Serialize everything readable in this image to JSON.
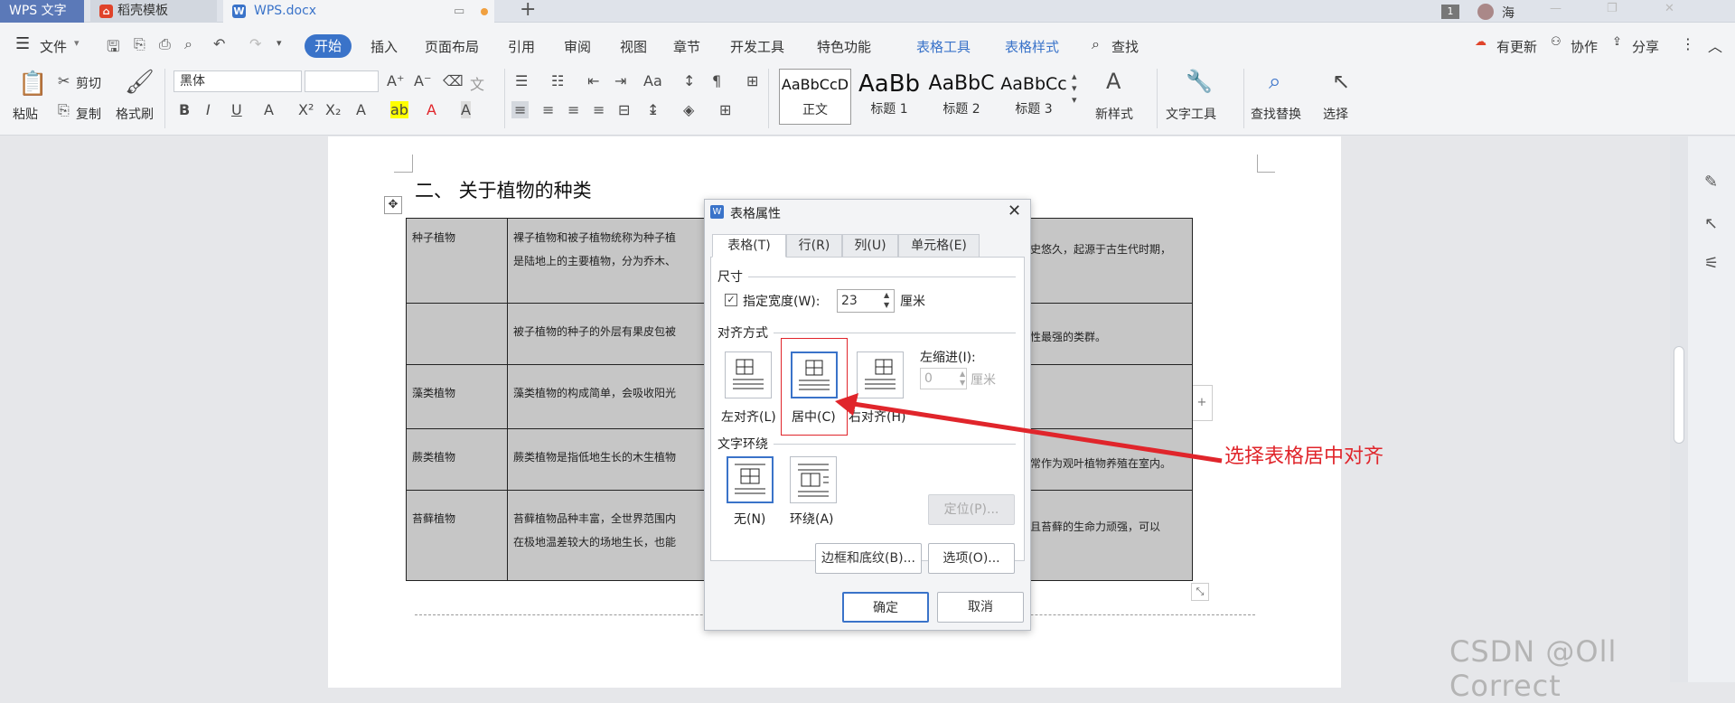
{
  "title_tabs": {
    "app": "WPS 文字",
    "template": "稻壳模板",
    "doc": "WPS.docx",
    "user_count": "1",
    "user_name": "海"
  },
  "menu": {
    "file": "文件",
    "start": "开始",
    "items": [
      "插入",
      "页面布局",
      "引用",
      "审阅",
      "视图",
      "章节",
      "开发工具",
      "特色功能"
    ],
    "table_tools": "表格工具",
    "table_style": "表格样式",
    "search": "查找",
    "update": "有更新",
    "collab": "协作",
    "share": "分享"
  },
  "ribbon": {
    "paste": "粘贴",
    "cut": "剪切",
    "copy": "复制",
    "format_painter": "格式刷",
    "font": "黑体",
    "styles": [
      {
        "sample": "AaBbCcD",
        "name": "正文"
      },
      {
        "sample": "AaBb",
        "name": "标题 1"
      },
      {
        "sample": "AaBbC",
        "name": "标题 2"
      },
      {
        "sample": "AaBbCc",
        "name": "标题 3"
      }
    ],
    "new_style": "新样式",
    "text_tools": "文字工具",
    "find_replace": "查找替换",
    "select": "选择"
  },
  "doc": {
    "heading": "二、 关于植物的种类",
    "rows": [
      {
        "name": "种子植物",
        "desc_left": "裸子植物和被子植物统称为种子植",
        "desc_left2": "是陆地上的主要植物，分为乔木、",
        "desc_right": "史悠久，起源于古生代时期，"
      },
      {
        "name": "",
        "desc_left": "被子植物的种子的外层有果皮包被",
        "desc_left2": "",
        "desc_right": "性最强的类群。"
      },
      {
        "name": "藻类植物",
        "desc_left": "藻类植物的构成简单，会吸收阳光",
        "desc_left2": "",
        "desc_right": ""
      },
      {
        "name": "蕨类植物",
        "desc_left": "蕨类植物是指低地生长的木生植物",
        "desc_left2": "",
        "desc_right": "常作为观叶植物养殖在室内。"
      },
      {
        "name": "苔藓植物",
        "desc_left": "苔藓植物品种丰富，全世界范围内",
        "desc_left2": "在极地温差较大的场地生长，也能",
        "desc_right": "且苔藓的生命力顽强，可以"
      }
    ]
  },
  "dialog": {
    "title": "表格属性",
    "tabs": [
      "表格(T)",
      "行(R)",
      "列(U)",
      "单元格(E)"
    ],
    "size_label": "尺寸",
    "specify_width": "指定宽度(W):",
    "width_value": "23",
    "unit": "厘米",
    "align_label": "对齐方式",
    "align_left": "左对齐(L)",
    "align_center": "居中(C)",
    "align_right": "右对齐(H)",
    "indent_label": "左缩进(I):",
    "indent_value": "0",
    "indent_unit": "厘米",
    "wrap_label": "文字环绕",
    "wrap_none": "无(N)",
    "wrap_around": "环绕(A)",
    "position_btn": "定位(P)...",
    "border_btn": "边框和底纹(B)...",
    "options_btn": "选项(O)...",
    "ok": "确定",
    "cancel": "取消"
  },
  "annotation": "选择表格居中对齐",
  "watermark": "CSDN @Oll Correct",
  "colors": {
    "accent": "#3a73c9",
    "annotation": "#e0252b"
  }
}
